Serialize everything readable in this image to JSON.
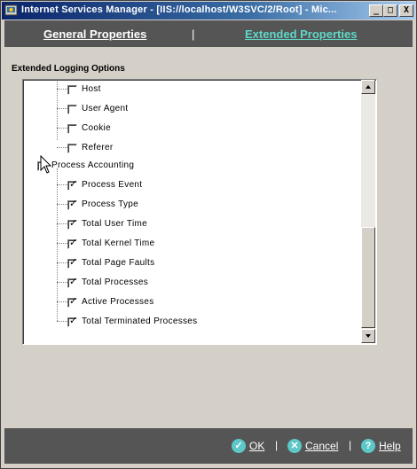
{
  "window": {
    "title": "Internet Services Manager - [IIS://localhost/W3SVC/2/Root] - Mic...",
    "minimize_glyph": "_",
    "maximize_glyph": "□",
    "close_glyph": "X"
  },
  "tabs": {
    "general": "General Properties",
    "separator": "|",
    "extended": "Extended Properties",
    "active_color": "#5ed8c8"
  },
  "section": {
    "label": "Extended Logging Options"
  },
  "tree": {
    "items": [
      {
        "label": "Host",
        "checked": false
      },
      {
        "label": "User Agent",
        "checked": false
      },
      {
        "label": "Cookie",
        "checked": false
      },
      {
        "label": "Referer",
        "checked": false
      },
      {
        "label": "Process Accounting",
        "checked": false
      },
      {
        "label": "Process Event",
        "checked": true
      },
      {
        "label": "Process Type",
        "checked": true
      },
      {
        "label": "Total User Time",
        "checked": true
      },
      {
        "label": "Total Kernel Time",
        "checked": true
      },
      {
        "label": "Total Page Faults",
        "checked": true
      },
      {
        "label": "Total Processes",
        "checked": true
      },
      {
        "label": "Active Processes",
        "checked": true
      },
      {
        "label": "Total Terminated Processes",
        "checked": true
      }
    ],
    "check_glyph": "✓"
  },
  "footer": {
    "ok": "OK",
    "cancel": "Cancel",
    "help": "Help",
    "separator": "|",
    "ok_icon_glyph": "✓",
    "cancel_icon_glyph": "✕",
    "help_icon_glyph": "?"
  }
}
